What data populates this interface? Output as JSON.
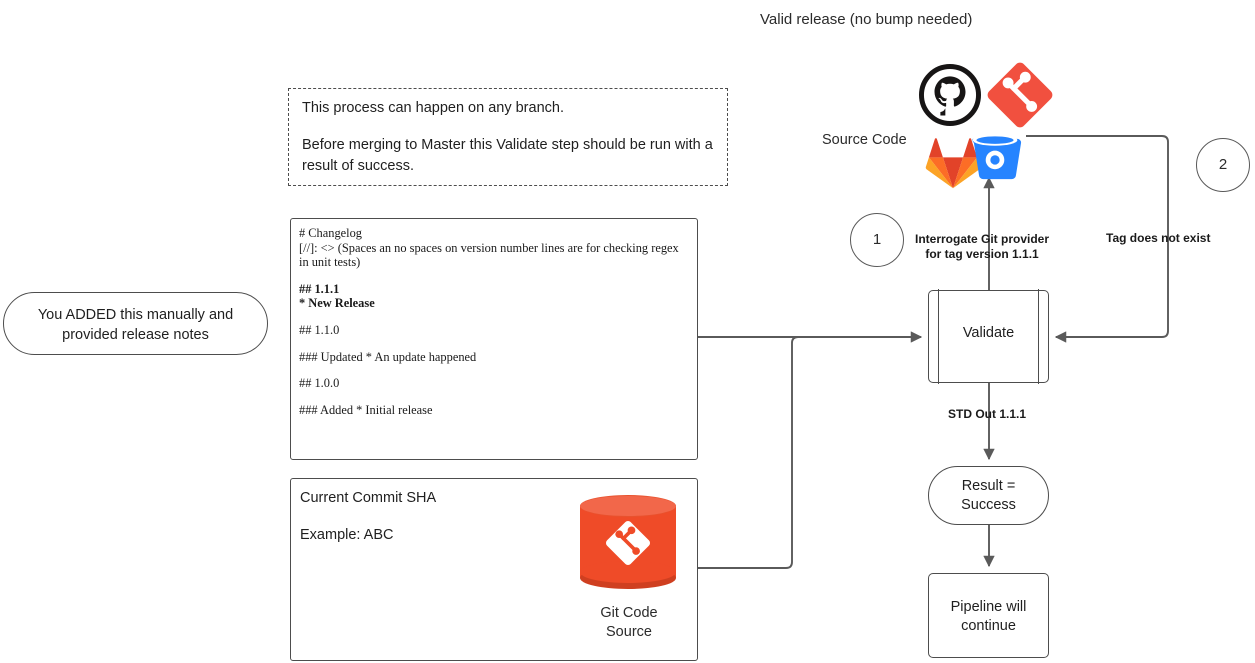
{
  "diagram": {
    "title": "Valid release (no bump needed)",
    "source_code_label": "Source Code"
  },
  "note": {
    "line1": "This process can happen on any branch.",
    "line2": "Before merging to Master this Validate step should be run with a result of success."
  },
  "changelog": {
    "heading": "# Changelog",
    "comment": "[//]: <> (Spaces an no spaces on version number lines are for checking regex in unit tests)",
    "entries": [
      {
        "version": "## 1.1.1",
        "detail": "* New Release",
        "bold": true
      },
      {
        "version": "## 1.1.0",
        "detail": "",
        "bold": false
      },
      {
        "version": "### Updated * An update happened",
        "detail": "",
        "bold": false
      },
      {
        "version": "## 1.0.0",
        "detail": "",
        "bold": false
      },
      {
        "version": "### Added * Initial release",
        "detail": "",
        "bold": false
      }
    ]
  },
  "callout": {
    "line1": "You ADDED this manually and",
    "line2": "provided release notes"
  },
  "commit": {
    "title": "Current Commit SHA",
    "example": "Example: ABC",
    "db_label_line1": "Git Code",
    "db_label_line2": "Source"
  },
  "nodes": {
    "validate": "Validate",
    "result_line1": "Result =",
    "result_line2": "Success",
    "pipeline_line1": "Pipeline will",
    "pipeline_line2": "continue"
  },
  "edges": {
    "interrogate_line1": "Interrogate Git provider",
    "interrogate_line2": "for tag version 1.1.1",
    "tag_does_not_exist": "Tag does not exist",
    "std_out": "STD Out 1.1.1"
  },
  "markers": {
    "one": "1",
    "two": "2"
  },
  "icons": {
    "github": "github-icon",
    "git": "git-icon",
    "gitlab": "gitlab-icon",
    "bitbucket": "bitbucket-icon",
    "database": "git-database-icon"
  },
  "colors": {
    "stroke": "#4d4d4d",
    "text": "#1f1f1f",
    "git_red": "#ef4b28",
    "gitlab_orange": "#fc6d26",
    "gitlab_red": "#e24329",
    "bitbucket_blue": "#2684ff",
    "github_dark": "#171515"
  }
}
